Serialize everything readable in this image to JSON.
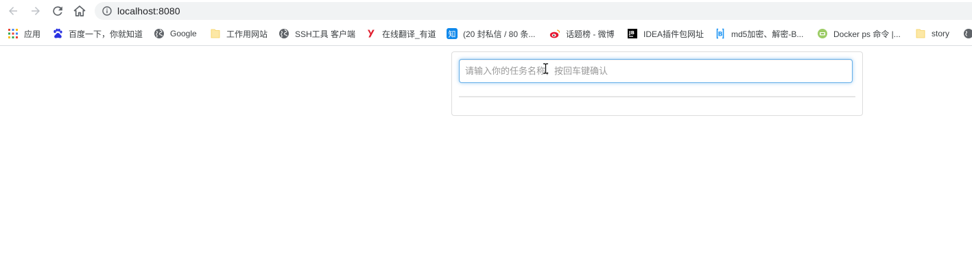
{
  "browser": {
    "url": "localhost:8080",
    "colors": {
      "omnibox_bg": "#f1f3f4",
      "icon_gray": "#5f6368",
      "disabled_gray": "#bdc1c6"
    }
  },
  "bookmarks": [
    {
      "label": "应用",
      "icon": "apps-grid-icon"
    },
    {
      "label": "百度一下，你就知道",
      "icon": "baidu-paw-icon"
    },
    {
      "label": "Google",
      "icon": "globe-icon"
    },
    {
      "label": "工作用网站",
      "icon": "folder-icon"
    },
    {
      "label": "SSH工具 客户端",
      "icon": "globe-icon"
    },
    {
      "label": "在线翻译_有道",
      "icon": "youdao-icon"
    },
    {
      "label": "(20 封私信 / 80 条...",
      "icon": "zhihu-icon"
    },
    {
      "label": "话题榜 - 微博",
      "icon": "weibo-icon"
    },
    {
      "label": "IDEA插件包网址",
      "icon": "jetbrains-icon"
    },
    {
      "label": "md5加密、解密-B...",
      "icon": "bejson-icon"
    },
    {
      "label": "Docker ps 命令 |...",
      "icon": "runoob-icon"
    },
    {
      "label": "story",
      "icon": "folder-icon"
    }
  ],
  "app": {
    "task_input_placeholder": "请输入你的任务名称，按回车键确认",
    "task_input_value": ""
  }
}
